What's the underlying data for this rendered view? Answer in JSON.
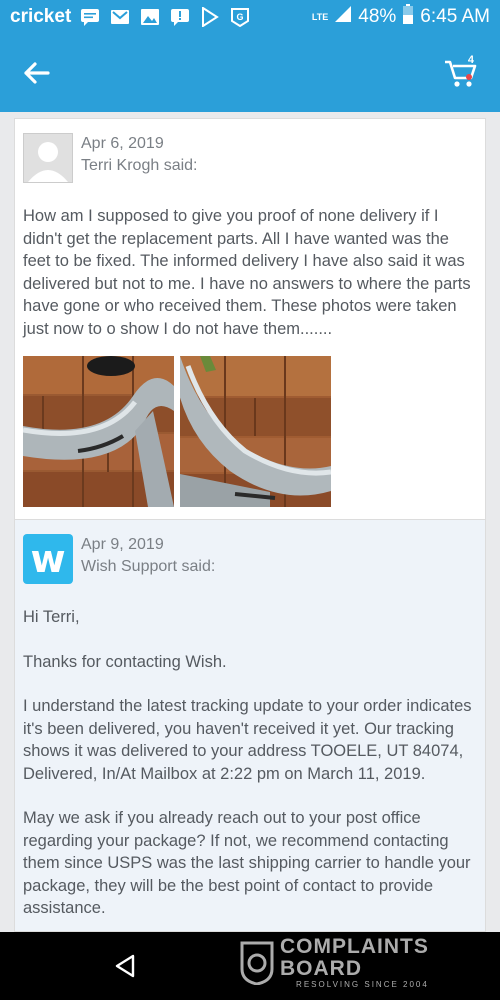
{
  "status_bar": {
    "carrier": "cricket",
    "network": "LTE",
    "battery": "48%",
    "time": "6:45 AM"
  },
  "app_bar": {
    "cart_count": "4"
  },
  "messages": [
    {
      "date": "Apr 6, 2019",
      "author_line": "Terri Krogh said:",
      "paragraphs": [
        "How am I supposed to give you proof of none delivery if I didn't get the replacement parts. All I have wanted was the feet to be fixed. The informed delivery I have also said it was delivered but not to me. I have no answers to where the parts have gone or who received them. These photos were taken just now to o show I do not have them......."
      ]
    },
    {
      "date": "Apr 9, 2019",
      "author_line": "Wish Support said:",
      "avatar_letter": "w",
      "paragraphs": [
        "Hi Terri,",
        "Thanks for contacting Wish.",
        "I understand the latest tracking update to your order indicates it's been delivered, you haven't received it yet. Our tracking shows it was delivered to your address TOOELE, UT 84074, Delivered, In/At Mailbox at 2:22 pm on March 11, 2019.",
        "May we ask if you already reach out to your post office regarding your package? If not, we recommend contacting them since USPS was the last shipping carrier to handle your package, they will be the best point of contact to provide assistance."
      ]
    }
  ],
  "watermark": {
    "title_line1": "COMPLAINTS",
    "title_line2": "BOARD",
    "subtitle": "RESOLVING SINCE 2004"
  },
  "colors": {
    "primary": "#2b9fd9",
    "wish_blue": "#2fb8ec",
    "support_bg": "#eef3f9"
  }
}
